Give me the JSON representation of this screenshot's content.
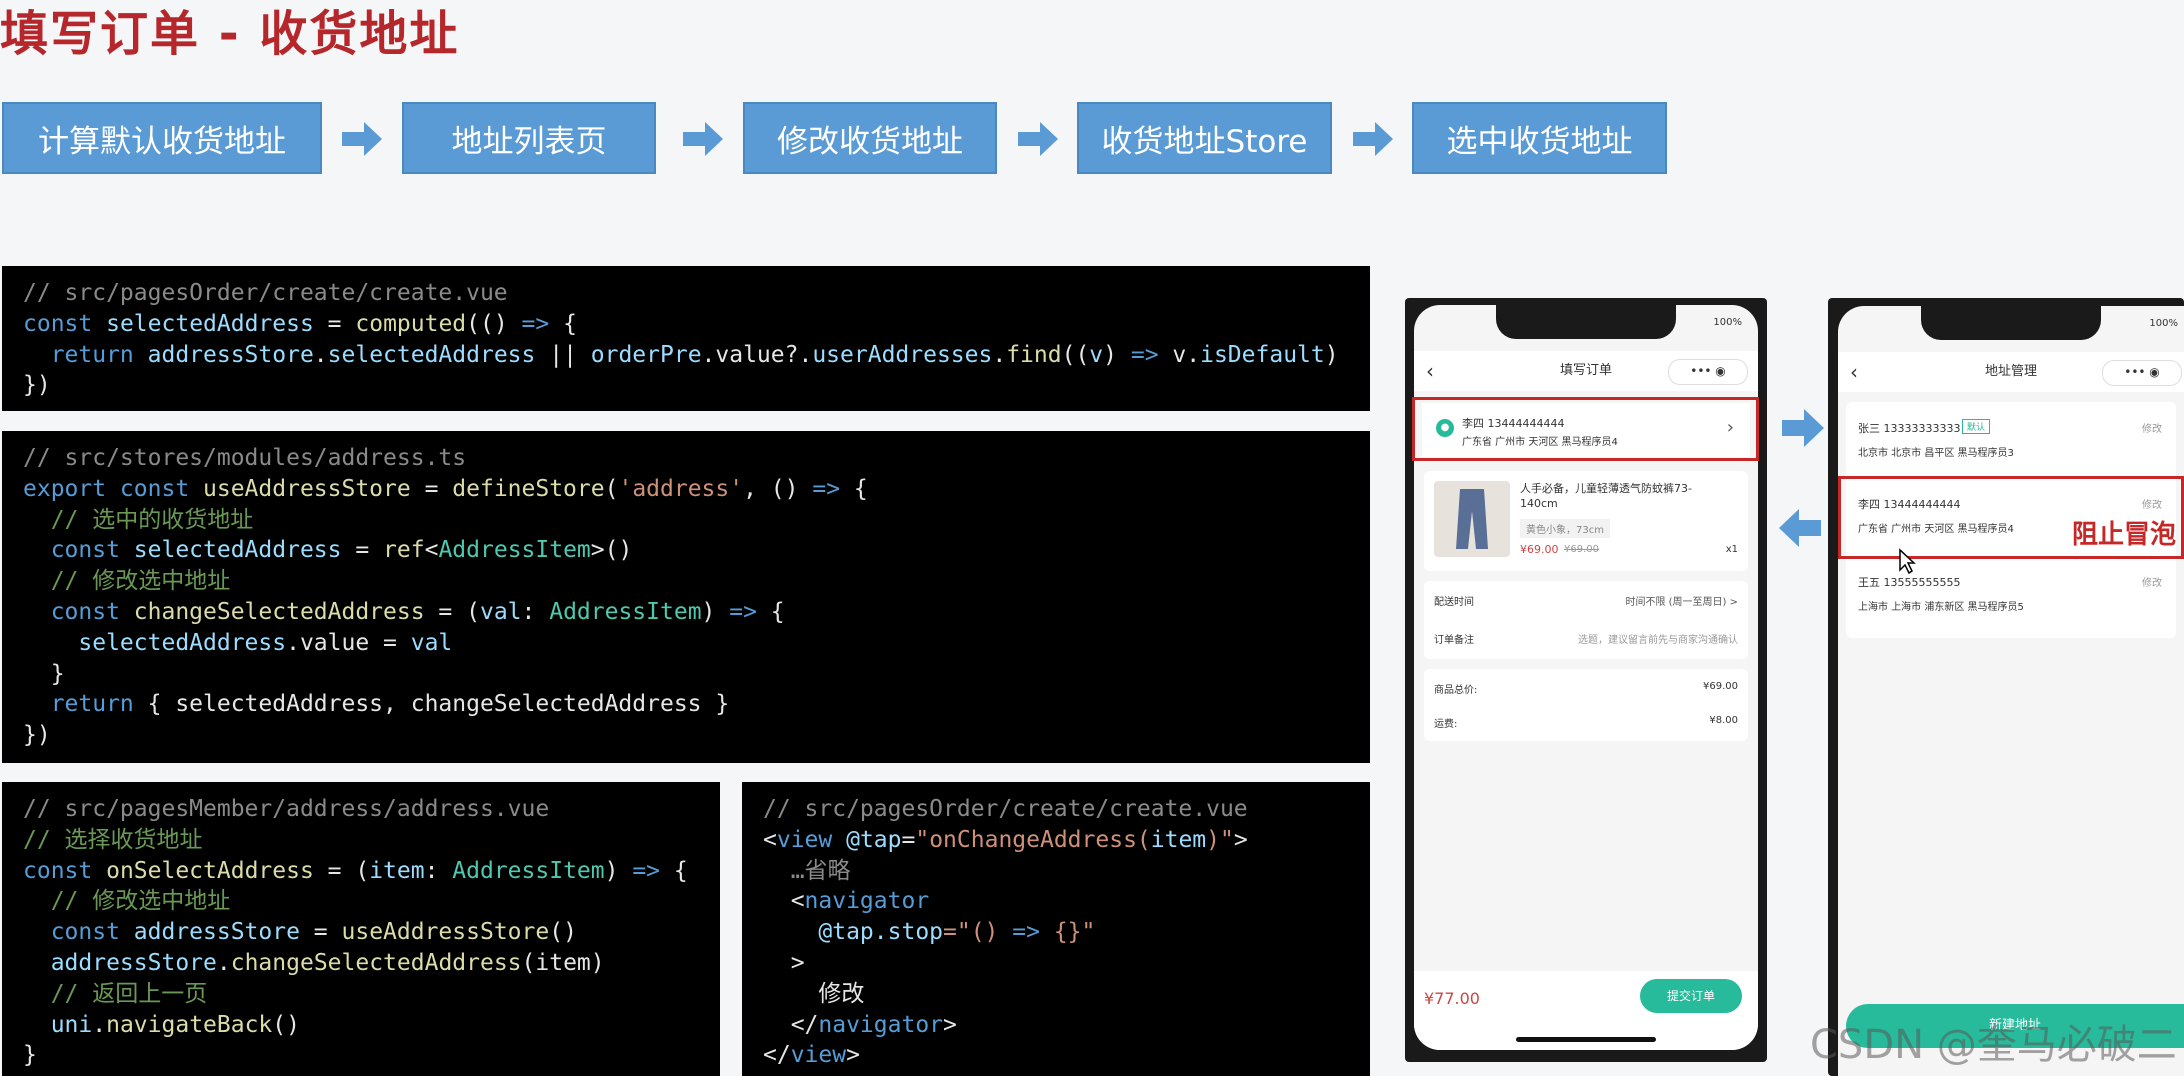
{
  "title": "填写订单 - 收货地址",
  "flow": [
    "计算默认收货地址",
    "地址列表页",
    "修改收货地址",
    "收货地址Store",
    "选中收货地址"
  ],
  "code1": {
    "l1": "// src/pagesOrder/create/create.vue",
    "l2a": "const",
    "l2b": "selectedAddress",
    "l2c": " = ",
    "l2d": "computed",
    "l2e": "(() ",
    "l2f": "=>",
    "l2g": " {",
    "l3a": "  return",
    "l3b": " addressStore",
    "l3c": ".",
    "l3d": "selectedAddress",
    "l3e": " || ",
    "l3f": "orderPre",
    "l3g": ".value?.",
    "l3h": "userAddresses",
    "l3i": ".",
    "l3j": "find",
    "l3k": "((",
    "l3l": "v",
    "l3m": ") ",
    "l3n": "=>",
    "l3o": " v.",
    "l3p": "isDefault",
    "l3q": ")",
    "l4": "})"
  },
  "code2": {
    "l1": "// src/stores/modules/address.ts",
    "l2a": "export const",
    "l2b": " useAddressStore",
    "l2c": " = ",
    "l2d": "defineStore",
    "l2e": "(",
    "l2f": "'address'",
    "l2g": ", () ",
    "l2h": "=>",
    "l2i": " {",
    "l3": "  // 选中的收货地址",
    "l4a": "  const",
    "l4b": " selectedAddress",
    "l4c": " = ",
    "l4d": "ref",
    "l4e": "<",
    "l4f": "AddressItem",
    "l4g": ">()",
    "l5": "  // 修改选中地址",
    "l6a": "  const",
    "l6b": " changeSelectedAddress",
    "l6c": " = (",
    "l6d": "val",
    "l6e": ": ",
    "l6f": "AddressItem",
    "l6g": ") ",
    "l6h": "=>",
    "l6i": " {",
    "l7a": "    selectedAddress",
    "l7b": ".value = ",
    "l7c": "val",
    "l8": "  }",
    "l9a": "  return",
    "l9b": " { selectedAddress, changeSelectedAddress }",
    "l10": "})"
  },
  "code3": {
    "l1": "// src/pagesMember/address/address.vue",
    "l2": "// 选择收货地址",
    "l3a": "const",
    "l3b": " onSelectAddress",
    "l3c": " = (",
    "l3d": "item",
    "l3e": ": ",
    "l3f": "AddressItem",
    "l3g": ") ",
    "l3h": "=>",
    "l3i": " {",
    "l4": "  // 修改选中地址",
    "l5a": "  const",
    "l5b": " addressStore",
    "l5c": " = ",
    "l5d": "useAddressStore",
    "l5e": "()",
    "l6a": "  addressStore",
    "l6b": ".",
    "l6c": "changeSelectedAddress",
    "l6d": "(item)",
    "l7": "  // 返回上一页",
    "l8a": "  uni",
    "l8b": ".",
    "l8c": "navigateBack",
    "l8d": "()",
    "l9": "}"
  },
  "code4": {
    "l1": "// src/pagesOrder/create/create.vue",
    "l2a": "<",
    "l2b": "view",
    "l2c": " @tap",
    "l2d": "=",
    "l2e": "\"onChangeAddress(",
    "l2f": "item",
    "l2g": ")\"",
    "l2h": ">",
    "l3": "  …省略",
    "l4a": "  <",
    "l4b": "navigator",
    "l5a": "    @tap.stop",
    "l5b": "=\"() ",
    "l5c": "=>",
    "l5d": " {}\"",
    "l6": "  >",
    "l7": "    修改",
    "l8a": "  </",
    "l8b": "navigator",
    "l8c": ">",
    "l9a": "</",
    "l9b": "view",
    "l9c": ">"
  },
  "phone1": {
    "battery": "100%",
    "nav_title": "填写订单",
    "address_name": "李四 13444444444",
    "address_detail": "广东省 广州市 天河区 黑马程序员4",
    "goods_title": "人手必备，儿童轻薄透气防蚊裤73-140cm",
    "goods_spec": "黄色小象，73cm",
    "goods_price": "¥69.00",
    "goods_orig": "¥69.00",
    "goods_qty": "x1",
    "delivery_label": "配送时间",
    "delivery_value": "时间不限 (周一至周日) >",
    "remark_label": "订单备注",
    "remark_value": "选题，建议留言前先与商家沟通确认",
    "total_label": "商品总价:",
    "total_value": "¥69.00",
    "freight_label": "运费:",
    "freight_value": "¥8.00",
    "pay_amount": "¥77.00",
    "submit_label": "提交订单"
  },
  "phone2": {
    "battery": "100%",
    "nav_title": "地址管理",
    "items": [
      {
        "name": "张三 13333333333",
        "badge": "默认",
        "detail": "北京市 北京市 昌平区 黑马程序员3",
        "edit": "修改"
      },
      {
        "name": "李四 13444444444",
        "badge": "",
        "detail": "广东省 广州市 天河区 黑马程序员4",
        "edit": "修改"
      },
      {
        "name": "王五 13555555555",
        "badge": "",
        "detail": "上海市 上海市 浦东新区 黑马程序员5",
        "edit": "修改"
      }
    ],
    "annotation": "阻止冒泡",
    "new_button": "新建地址"
  },
  "watermark": "CSDN @奎马必破二",
  "colors": {
    "step_bg": "#5b9bd5",
    "title": "#b5272a",
    "highlight": "#c62828",
    "accent": "#27ba9b"
  }
}
